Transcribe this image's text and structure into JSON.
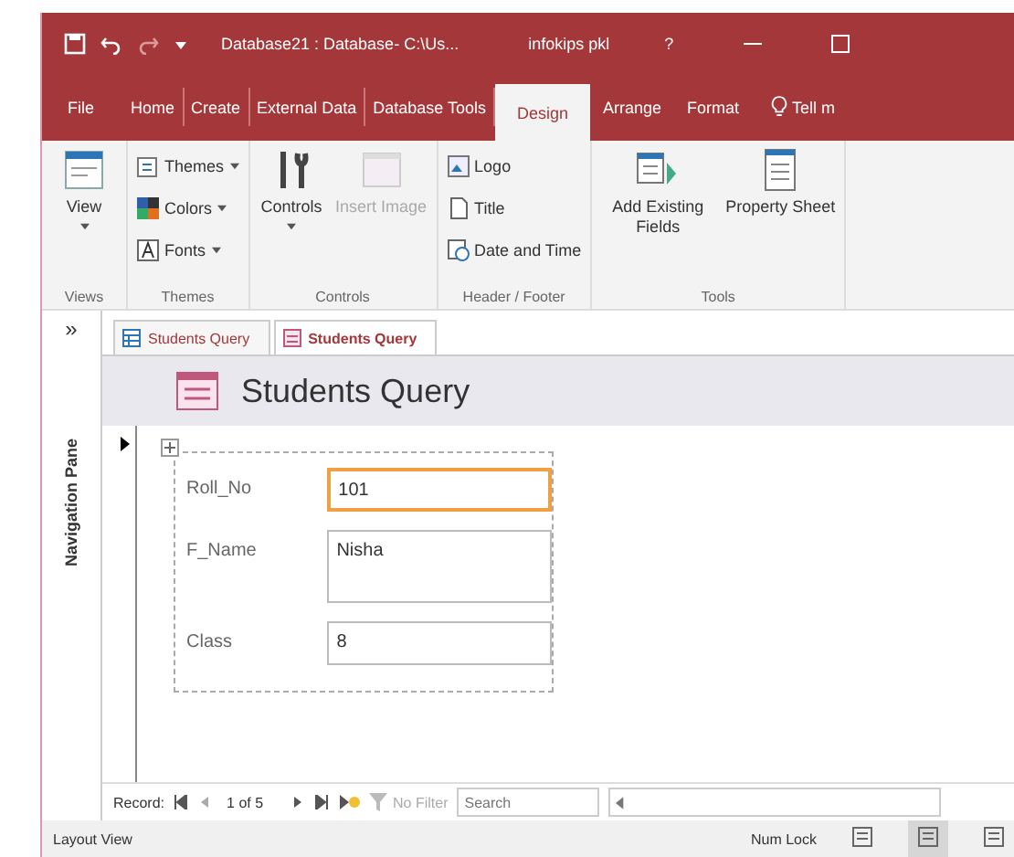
{
  "title_bar": {
    "title": "Database21 : Database- C:\\Us...",
    "user": "infokips pkl",
    "help": "?"
  },
  "ribbon_tabs": [
    {
      "label": "File",
      "selected": false
    },
    {
      "label": "Home",
      "selected": false
    },
    {
      "label": "Create",
      "selected": false
    },
    {
      "label": "External Data",
      "selected": false
    },
    {
      "label": "Database Tools",
      "selected": false
    },
    {
      "label": "Design",
      "selected": true
    },
    {
      "label": "Arrange",
      "selected": false
    },
    {
      "label": "Format",
      "selected": false
    }
  ],
  "tell_me": "Tell m",
  "ribbon_groups": [
    {
      "name": "Views",
      "items": [
        {
          "kind": "large",
          "label": "View",
          "disabled": false
        }
      ]
    },
    {
      "name": "Themes",
      "items": [
        {
          "kind": "small",
          "label": "Themes",
          "disabled": false
        },
        {
          "kind": "small",
          "label": "Colors",
          "disabled": false
        },
        {
          "kind": "small",
          "label": "Fonts",
          "disabled": false
        }
      ]
    },
    {
      "name": "Controls",
      "items": [
        {
          "kind": "large",
          "label": "Controls",
          "disabled": false
        },
        {
          "kind": "large",
          "label": "Insert Image",
          "disabled": true
        }
      ]
    },
    {
      "name": "Header / Footer",
      "items": [
        {
          "kind": "small",
          "label": "Logo",
          "disabled": false
        },
        {
          "kind": "small",
          "label": "Title",
          "disabled": false
        },
        {
          "kind": "small",
          "label": "Date and Time",
          "disabled": false
        }
      ]
    },
    {
      "name": "Tools",
      "items": [
        {
          "kind": "large",
          "label": "Add Existing Fields",
          "disabled": false
        },
        {
          "kind": "large",
          "label": "Property Sheet",
          "disabled": false
        }
      ]
    }
  ],
  "navigation_pane": {
    "toggle": "»",
    "label": "Navigation Pane"
  },
  "document_tabs": [
    {
      "label": "Students Query",
      "selected": false
    },
    {
      "label": "Students Query",
      "selected": true
    }
  ],
  "form": {
    "title": "Students Query",
    "fields": [
      {
        "label": "Roll_No",
        "value": "101",
        "focused": true,
        "kind": "short"
      },
      {
        "label": "F_Name",
        "value": "Nisha",
        "focused": false,
        "kind": "tall"
      },
      {
        "label": "Class",
        "value": "8",
        "focused": false,
        "kind": "short"
      }
    ]
  },
  "record_nav": {
    "label": "Record:",
    "position": "1 of 5",
    "filter": "No Filter",
    "filter_disabled": true,
    "search_placeholder": "Search"
  },
  "status_bar": {
    "mode": "Layout View",
    "indicator": "Num Lock",
    "views": [
      {
        "selected": false
      },
      {
        "selected": true
      },
      {
        "selected": false
      }
    ]
  }
}
